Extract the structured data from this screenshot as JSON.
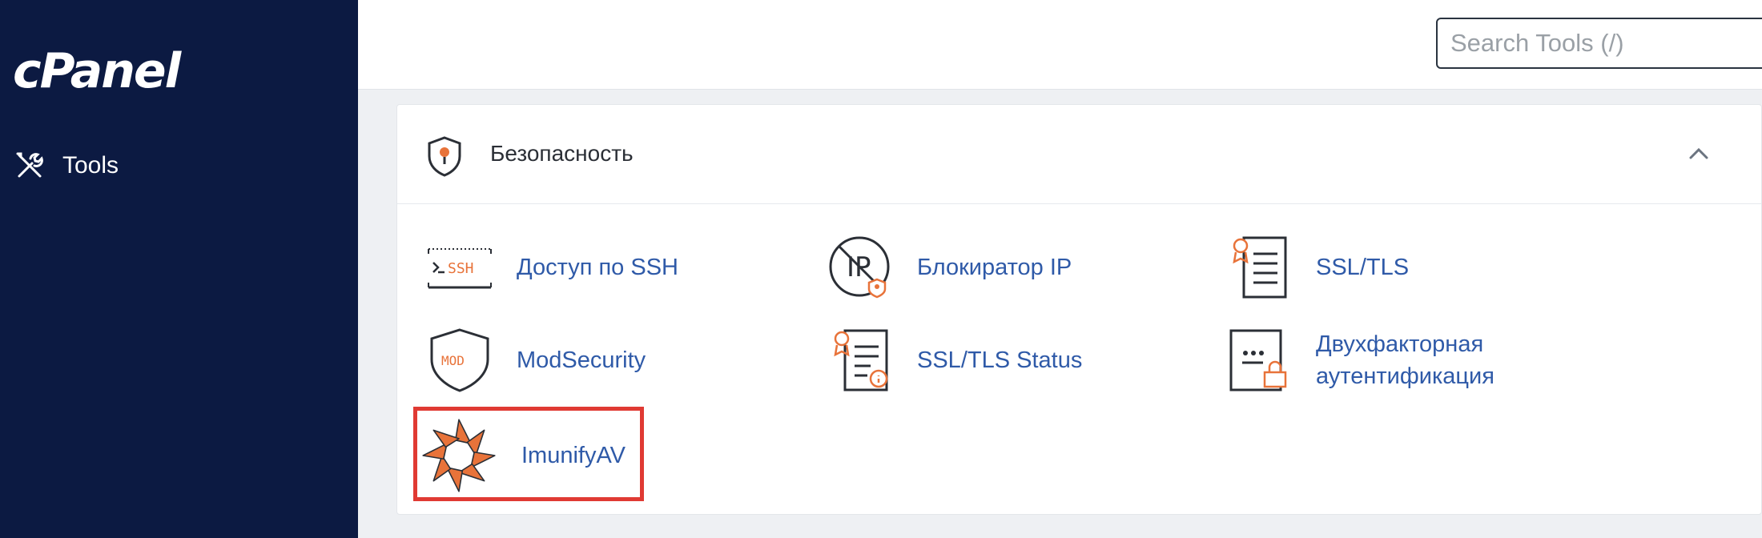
{
  "sidebar": {
    "logo_text": "cPanel",
    "nav_items": [
      {
        "label": "Tools",
        "icon": "tools-icon"
      }
    ],
    "background": "#0c1a42"
  },
  "header": {
    "search_placeholder": "Search Tools (/)"
  },
  "section": {
    "title": "Безопасность",
    "icon": "shield-icon",
    "expanded": true,
    "tools": [
      {
        "label": "Доступ по SSH",
        "icon": "ssh-icon"
      },
      {
        "label": "Блокиратор IP",
        "icon": "ip-blocker-icon"
      },
      {
        "label": "SSL/TLS",
        "icon": "certificate-icon"
      },
      {
        "label": "ModSecurity",
        "icon": "mod-shield-icon"
      },
      {
        "label": "SSL/TLS Status",
        "icon": "certificate-status-icon"
      },
      {
        "label": "Двухфакторная аутентификация",
        "label_line1": "Двухфакторная",
        "label_line2": "аутентификация",
        "icon": "two-factor-icon"
      },
      {
        "label": "ImunifyAV",
        "icon": "imunify-icon"
      }
    ]
  },
  "colors": {
    "link": "#2f5aa8",
    "accent_orange": "#e8733a",
    "highlight": "#e03a33"
  }
}
